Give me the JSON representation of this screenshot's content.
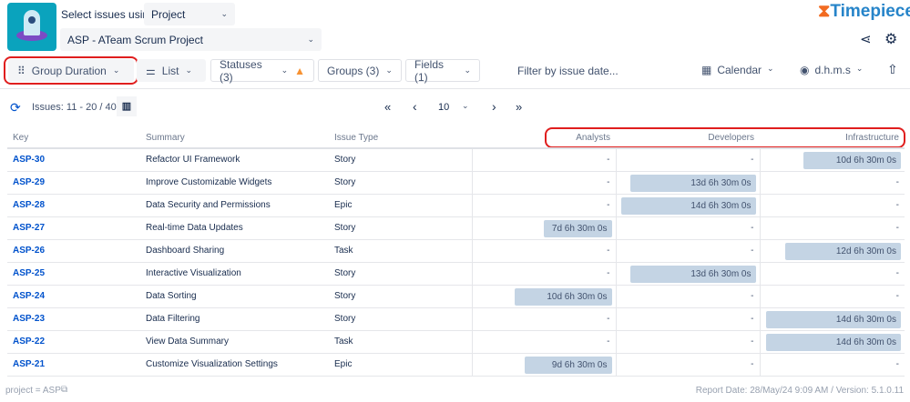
{
  "header": {
    "select_label": "Select issues using",
    "select_value": "Project",
    "project_value": "ASP - ATeam Scrum Project",
    "brand": "Timepiece"
  },
  "toolbar": {
    "group_duration": "Group Duration",
    "list": "List",
    "statuses": "Statuses (3)",
    "groups": "Groups (3)",
    "fields": "Fields (1)",
    "filter_date": "Filter by issue date...",
    "calendar": "Calendar",
    "format": "d.h.m.s"
  },
  "pager": {
    "issues": "Issues: 11 - 20 / 40",
    "first": "«",
    "prev": "‹",
    "page_size": "10",
    "next": "›",
    "last": "»"
  },
  "table": {
    "columns": [
      "Key",
      "Summary",
      "Issue Type",
      "Analysts",
      "Developers",
      "Infrastructure"
    ],
    "rows": [
      {
        "key": "ASP-30",
        "summary": "Refactor UI Framework",
        "type": "Story",
        "vals": [
          "-",
          "-",
          "10d 6h 30m 0s"
        ],
        "days": [
          0,
          0,
          10.27
        ]
      },
      {
        "key": "ASP-29",
        "summary": "Improve Customizable Widgets",
        "type": "Story",
        "vals": [
          "-",
          "13d 6h 30m 0s",
          "-"
        ],
        "days": [
          0,
          13.27,
          0
        ]
      },
      {
        "key": "ASP-28",
        "summary": "Data Security and Permissions",
        "type": "Epic",
        "vals": [
          "-",
          "14d 6h 30m 0s",
          "-"
        ],
        "days": [
          0,
          14.27,
          0
        ]
      },
      {
        "key": "ASP-27",
        "summary": "Real-time Data Updates",
        "type": "Story",
        "vals": [
          "7d 6h 30m 0s",
          "-",
          "-"
        ],
        "days": [
          7.27,
          0,
          0
        ]
      },
      {
        "key": "ASP-26",
        "summary": "Dashboard Sharing",
        "type": "Task",
        "vals": [
          "-",
          "-",
          "12d 6h 30m 0s"
        ],
        "days": [
          0,
          0,
          12.27
        ]
      },
      {
        "key": "ASP-25",
        "summary": "Interactive Visualization",
        "type": "Story",
        "vals": [
          "-",
          "13d 6h 30m 0s",
          "-"
        ],
        "days": [
          0,
          13.27,
          0
        ]
      },
      {
        "key": "ASP-24",
        "summary": "Data Sorting",
        "type": "Story",
        "vals": [
          "10d 6h 30m 0s",
          "-",
          "-"
        ],
        "days": [
          10.27,
          0,
          0
        ]
      },
      {
        "key": "ASP-23",
        "summary": "Data Filtering",
        "type": "Story",
        "vals": [
          "-",
          "-",
          "14d 6h 30m 0s"
        ],
        "days": [
          0,
          0,
          14.27
        ]
      },
      {
        "key": "ASP-22",
        "summary": "View Data Summary",
        "type": "Task",
        "vals": [
          "-",
          "-",
          "14d 6h 30m 0s"
        ],
        "days": [
          0,
          0,
          14.27
        ]
      },
      {
        "key": "ASP-21",
        "summary": "Customize Visualization Settings",
        "type": "Epic",
        "vals": [
          "9d 6h 30m 0s",
          "-",
          "-"
        ],
        "days": [
          9.27,
          0,
          0
        ]
      }
    ]
  },
  "footer": {
    "jql": "project = ASP",
    "report": "Report Date: 28/May/24 9:09 AM / Version: 5.1.0.11"
  }
}
